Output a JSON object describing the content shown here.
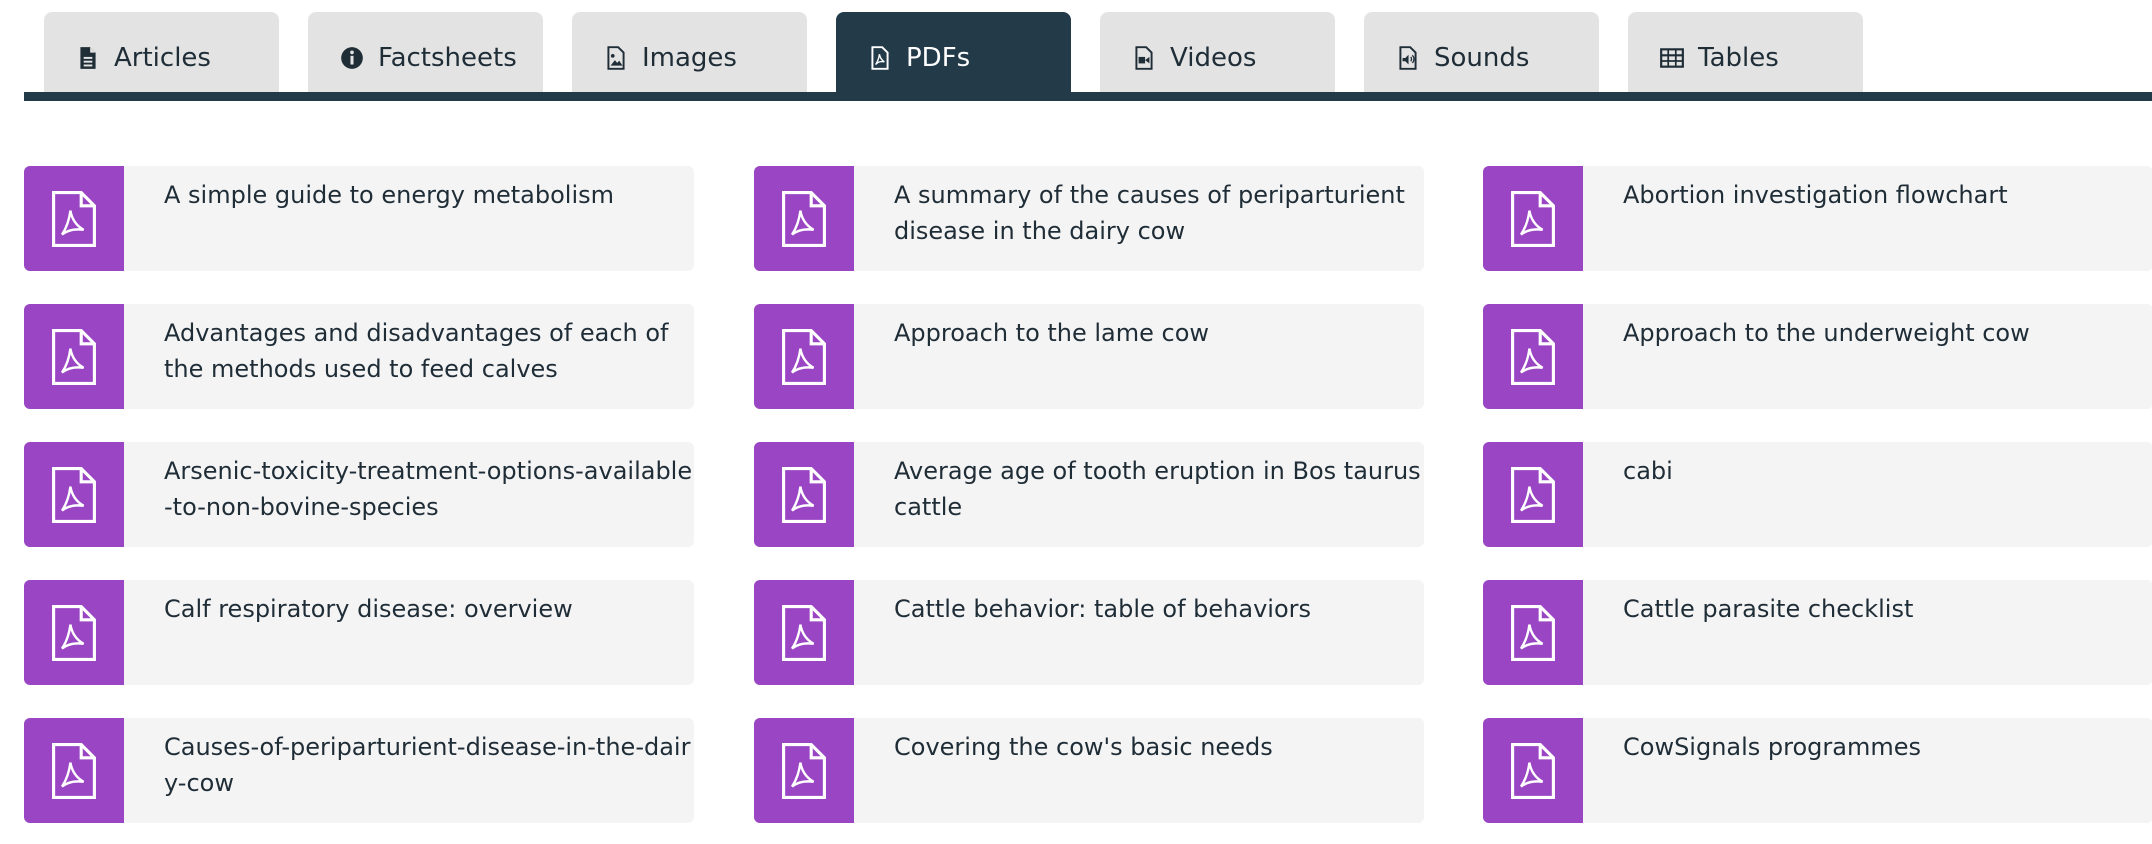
{
  "tabs": [
    {
      "label": "Articles",
      "icon": "document-icon"
    },
    {
      "label": "Factsheets",
      "icon": "info-icon"
    },
    {
      "label": "Images",
      "icon": "image-file-icon"
    },
    {
      "label": "PDFs",
      "icon": "pdf-file-icon",
      "active": true
    },
    {
      "label": "Videos",
      "icon": "video-file-icon"
    },
    {
      "label": "Sounds",
      "icon": "audio-file-icon"
    },
    {
      "label": "Tables",
      "icon": "table-icon"
    }
  ],
  "colors": {
    "tab_active": "#233a49",
    "tab_inactive": "#e3e3e3",
    "pdf_badge": "#9a46c4",
    "card_bg": "#f5f4f5"
  },
  "pdfs": [
    {
      "title": "A simple guide to energy metabolism"
    },
    {
      "title": "A summary of the causes of periparturient disease in the dairy cow"
    },
    {
      "title": "Abortion investigation flowchart"
    },
    {
      "title": "Advantages and disadvantages of each of the methods used to feed calves"
    },
    {
      "title": "Approach to the lame cow"
    },
    {
      "title": "Approach to the underweight cow"
    },
    {
      "title": "Arsenic-toxicity-treatment-options-available-to-non-bovine-species"
    },
    {
      "title": "Average age of tooth eruption in Bos taurus cattle"
    },
    {
      "title": "cabi"
    },
    {
      "title": "Calf respiratory disease: overview"
    },
    {
      "title": "Cattle behavior: table of behaviors"
    },
    {
      "title": "Cattle parasite checklist"
    },
    {
      "title": "Causes-of-periparturient-disease-in-the-dairy-cow"
    },
    {
      "title": "Covering the cow's basic needs"
    },
    {
      "title": "CowSignals programmes"
    }
  ]
}
